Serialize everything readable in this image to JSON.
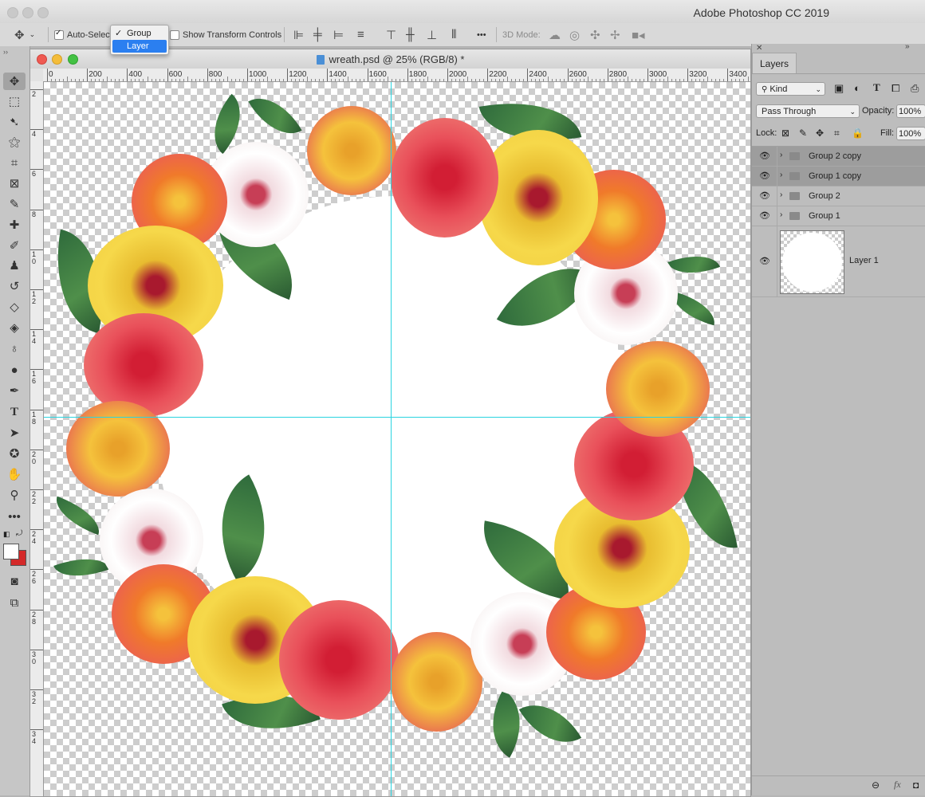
{
  "app": {
    "title": "Adobe Photoshop CC 2019"
  },
  "options_bar": {
    "auto_select_label": "Auto-Select",
    "auto_select_checked": true,
    "dropdown_options": [
      {
        "label": "Group",
        "checked": true
      },
      {
        "label": "Layer",
        "highlighted": true
      }
    ],
    "show_transform_label": "Show Transform Controls",
    "three_d_mode_label": "3D Mode:",
    "more_label": "•••"
  },
  "document": {
    "title": "wreath.psd @ 25% (RGB/8) *",
    "ruler_h_ticks": [
      "0",
      "200",
      "400",
      "600",
      "800",
      "1000",
      "1200",
      "1400",
      "1600",
      "1800",
      "2000",
      "2200",
      "2400",
      "2600",
      "2800",
      "3000",
      "3200",
      "3400"
    ],
    "ruler_v_ticks": [
      "2",
      "4",
      "6",
      "8",
      "1\n0",
      "1\n2",
      "1\n4",
      "1\n6",
      "1\n8",
      "2\n0",
      "2\n2",
      "2\n4",
      "2\n6",
      "2\n8",
      "3\n0",
      "3\n2",
      "3\n4"
    ]
  },
  "layers_panel": {
    "tab_label": "Layers",
    "filter_label": "Kind",
    "blend_mode": "Pass Through",
    "opacity_label": "Opacity:",
    "opacity_value": "100%",
    "lock_label": "Lock:",
    "fill_label": "Fill:",
    "fill_value": "100%",
    "layers": [
      {
        "name": "Group 2 copy",
        "type": "group",
        "selected": true
      },
      {
        "name": "Group 1 copy",
        "type": "group",
        "selected": true
      },
      {
        "name": "Group 2",
        "type": "group",
        "selected": false
      },
      {
        "name": "Group 1",
        "type": "group",
        "selected": false
      },
      {
        "name": "Layer 1",
        "type": "pixel",
        "selected": false
      }
    ],
    "footer_fx": "fx"
  },
  "colors": {
    "guide": "#29d4e0",
    "selection": "#2b7ff0",
    "foreground": "#ffffff",
    "background": "#d42a2a"
  }
}
